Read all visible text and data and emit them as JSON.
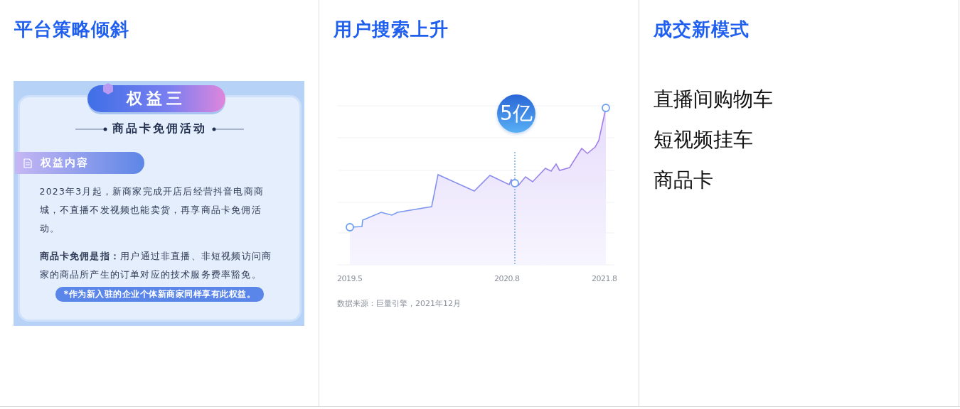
{
  "columns": [
    {
      "title": "平台策略倾斜",
      "kind": "image_card",
      "card": {
        "ribbon": "权益三",
        "subtitle": "商品卡免佣活动",
        "section_label": "权益内容",
        "paragraphs": [
          "2023年3月起，新商家完成开店后经营抖音电商商城，不直播不发视频也能卖货，再享商品卡免佣活动。",
          "**商品卡免佣是指：**用户通过非直播、非短视频访问商家的商品所产生的订单对应的技术服务费率豁免。"
        ],
        "note": "*作为新入驻的企业个体新商家同样享有此权益。"
      }
    },
    {
      "title": "用户搜索上升",
      "kind": "chart",
      "chart": {
        "callout": "5亿",
        "x_labels": [
          "2019.5",
          "2020.8",
          "2021.8"
        ],
        "source": "数据来源：巨量引擎，2021年12月"
      }
    },
    {
      "title": "成交新模式",
      "kind": "list",
      "items": [
        "直播间购物车",
        "短视频挂车",
        "商品卡"
      ]
    }
  ]
}
